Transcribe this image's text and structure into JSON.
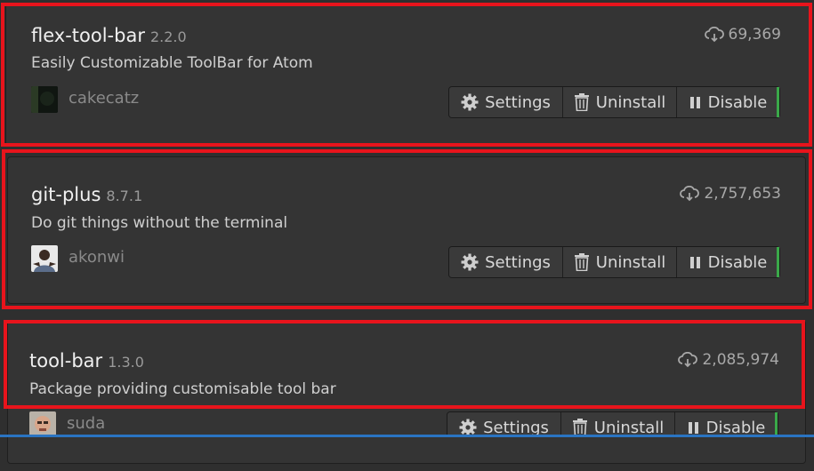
{
  "packages": [
    {
      "name": "flex-tool-bar",
      "version": "2.2.0",
      "description": "Easily Customizable ToolBar for Atom",
      "downloads": "69,369",
      "owner": "cakecatz",
      "buttons": {
        "settings": "Settings",
        "uninstall": "Uninstall",
        "disable": "Disable"
      }
    },
    {
      "name": "git-plus",
      "version": "8.7.1",
      "description": "Do git things without the terminal",
      "downloads": "2,757,653",
      "owner": "akonwi",
      "buttons": {
        "settings": "Settings",
        "uninstall": "Uninstall",
        "disable": "Disable"
      }
    },
    {
      "name": "tool-bar",
      "version": "1.3.0",
      "description": "Package providing customisable tool bar",
      "downloads": "2,085,974",
      "owner": "suda",
      "buttons": {
        "settings": "Settings",
        "uninstall": "Uninstall",
        "disable": "Disable"
      }
    }
  ],
  "icons": {
    "download": "cloud-download-icon",
    "settings": "gear-icon",
    "uninstall": "trash-icon",
    "disable": "pause-icon"
  },
  "colors": {
    "highlight": "#e8141c",
    "enabled_indicator": "#3aa949",
    "focus_line": "#2a74c2"
  }
}
